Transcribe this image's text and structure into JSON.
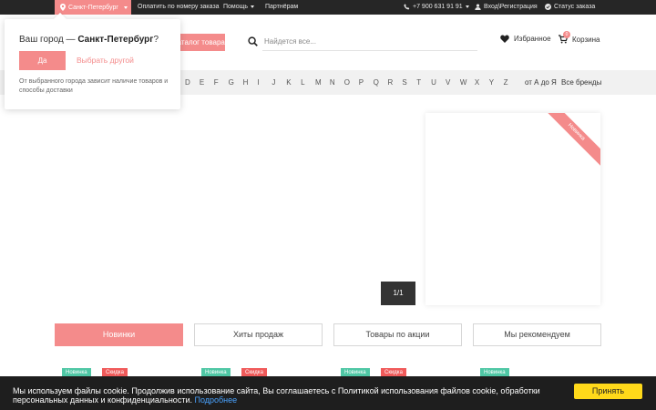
{
  "topbar": {
    "city": "Санкт-Петербург",
    "pay_order": "Оплатить по номеру заказа",
    "help": "Помощь",
    "partners": "Партнёрам",
    "phone": "+7 900 631 91 91",
    "login": "Вход\\Регистрация",
    "order_status": "Статус заказа"
  },
  "header": {
    "catalog_label": "Каталог товара",
    "search_placeholder": "Найдется все...",
    "favorites_label": "Избранное",
    "cart_label": "Корзина",
    "cart_count": "0"
  },
  "brands": {
    "letters": [
      "D",
      "E",
      "F",
      "G",
      "H",
      "I",
      "J",
      "K",
      "L",
      "M",
      "N",
      "O",
      "P",
      "Q",
      "R",
      "S",
      "T",
      "U",
      "V",
      "W",
      "X",
      "Y",
      "Z"
    ],
    "range_label": "от А до Я",
    "all_label": "Все бренды"
  },
  "slider": {
    "pager": "1/1",
    "ribbon": "Новинка"
  },
  "tabs": [
    "Новинки",
    "Хиты продаж",
    "Товары по акции",
    "Мы рекомендуем"
  ],
  "product_tags": {
    "new": "Новинка",
    "sale": "Скидка"
  },
  "city_popup": {
    "question_prefix": "Ваш город — ",
    "city": "Санкт-Петербург",
    "question_suffix": "?",
    "yes": "Да",
    "choose_other": "Выбрать другой",
    "note": "От выбранного города зависит наличие товаров и способы доставки"
  },
  "cookie": {
    "text": "Мы используем файлы cookie. Продолжив использование сайта, Вы соглашаетесь с Политикой использования файлов cookie, обработки персональных данных и конфиденциальности.",
    "more_link": "Подробнее",
    "accept": "Принять"
  },
  "colors": {
    "accent": "#f48b8b",
    "topbar_bg": "#262626",
    "tag_new": "#4fc7a5",
    "tag_sale": "#f05a5a",
    "cookie_button": "#ffd91a"
  }
}
